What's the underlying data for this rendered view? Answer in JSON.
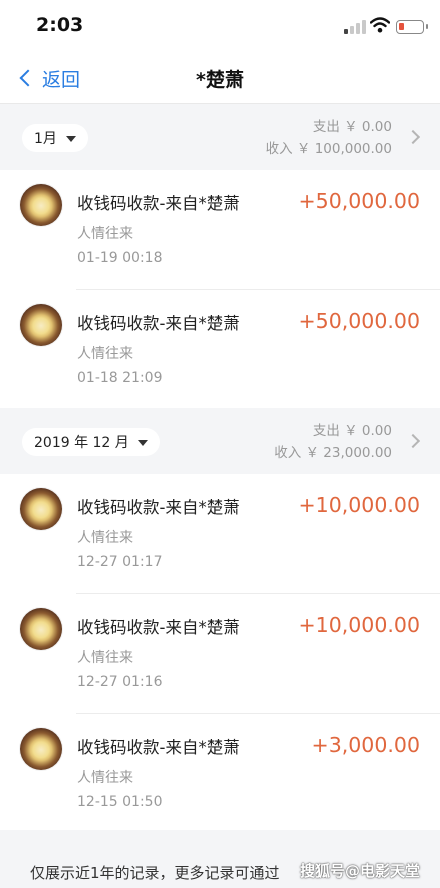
{
  "status_bar": {
    "time": "2:03"
  },
  "nav": {
    "back_label": "返回",
    "title": "*楚萧"
  },
  "sections": [
    {
      "month": "1月",
      "expense": "支出 ￥ 0.00",
      "income": "收入 ￥ 100,000.00",
      "transactions": [
        {
          "title": "收钱码收款-来自*楚萧",
          "category": "人情往来",
          "time": "01-19  00:18",
          "amount": "+50,000.00"
        },
        {
          "title": "收钱码收款-来自*楚萧",
          "category": "人情往来",
          "time": "01-18  21:09",
          "amount": "+50,000.00"
        }
      ]
    },
    {
      "month": "2019 年 12 月",
      "expense": "支出 ￥ 0.00",
      "income": "收入 ￥ 23,000.00",
      "transactions": [
        {
          "title": "收钱码收款-来自*楚萧",
          "category": "人情往来",
          "time": "12-27  01:17",
          "amount": "+10,000.00"
        },
        {
          "title": "收钱码收款-来自*楚萧",
          "category": "人情往来",
          "time": "12-27  01:16",
          "amount": "+10,000.00"
        },
        {
          "title": "收钱码收款-来自*楚萧",
          "category": "人情往来",
          "time": "12-15  01:50",
          "amount": "+3,000.00"
        }
      ]
    }
  ],
  "footer": {
    "note": "仅展示近1年的记录，更多记录可通过",
    "watermark": "搜狐号@电影天堂"
  },
  "colors": {
    "accent": "#2a7de1",
    "amount": "#e0673e",
    "section_bg": "#f4f5f7",
    "battery": "#e5533d"
  },
  "battery_level": 0.22,
  "icons": {
    "back": "chevron-left-icon",
    "month_caret": "caret-down-icon",
    "summary": "chevron-right-icon",
    "wifi": "wifi-icon",
    "signal": "signal-icon",
    "battery": "battery-icon"
  }
}
